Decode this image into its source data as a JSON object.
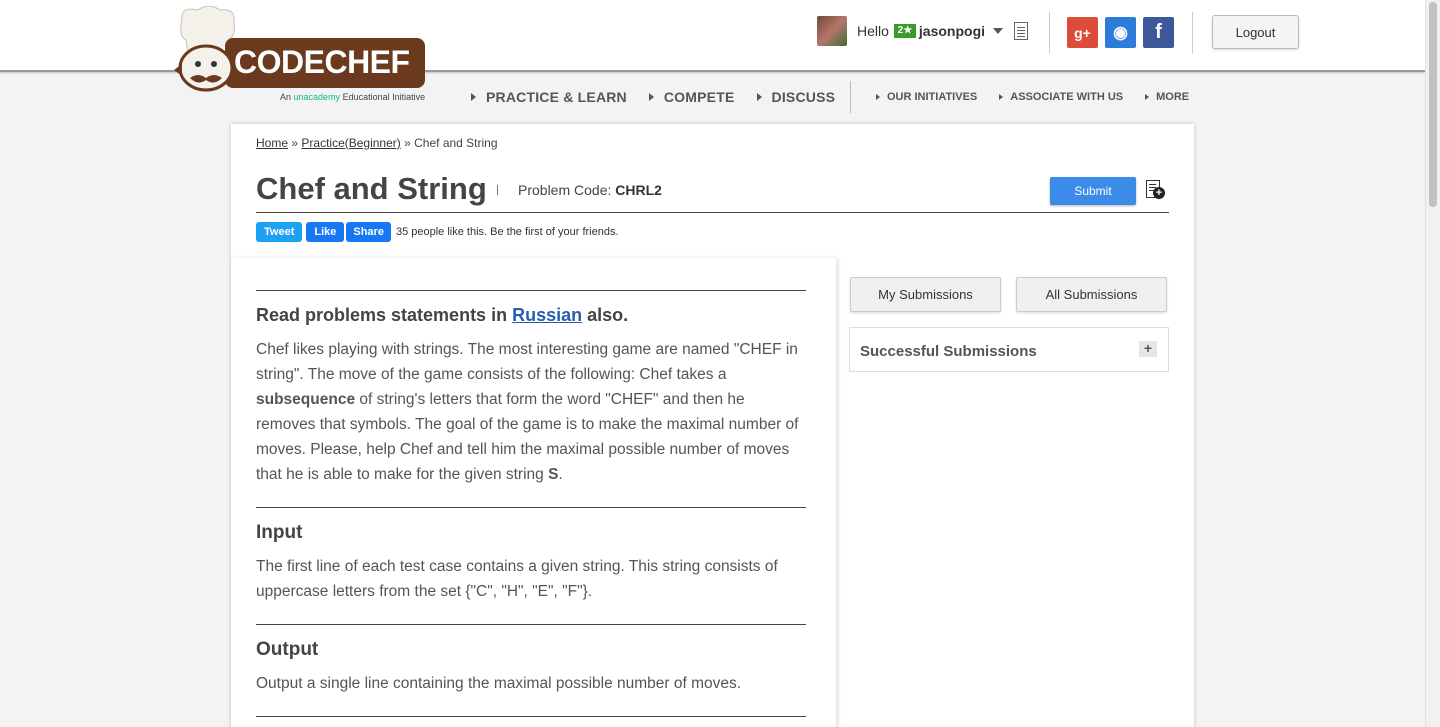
{
  "header": {
    "logo_text": "CODECHEF",
    "logo_sub_prefix": "An",
    "logo_sub_brand": "unacademy",
    "logo_sub_suffix": "Educational Initiative",
    "greeting": "Hello",
    "star_badge": "2★",
    "username": "jasonpogi",
    "social": {
      "gplus": "g+",
      "github": "◉",
      "facebook": "f"
    },
    "logout_label": "Logout"
  },
  "nav": {
    "main": [
      "PRACTICE & LEARN",
      "COMPETE",
      "DISCUSS"
    ],
    "secondary": [
      "OUR INITIATIVES",
      "ASSOCIATE WITH US",
      "MORE"
    ]
  },
  "breadcrumb": {
    "home": "Home",
    "sep1": "»",
    "practice": "Practice(Beginner)",
    "sep2": "»",
    "current": "Chef and String"
  },
  "problem": {
    "title": "Chef and String",
    "code_label": "Problem Code:",
    "code": "CHRL2",
    "submit_label": "Submit"
  },
  "share": {
    "tweet": "Tweet",
    "like": "Like",
    "share": "Share",
    "likes_text": "35 people like this. Be the first of your friends."
  },
  "statement": {
    "read_prefix": "Read problems statements in",
    "read_link": "Russian",
    "read_suffix": "also.",
    "body_1": "Chef likes playing with strings. The most interesting game are named \"CHEF in string\". The move of the game consists of the following: Chef takes a",
    "body_bold": "subsequence",
    "body_2": "of string's letters that form the word \"CHEF\" and then he removes that symbols. The goal of the game is to make the maximal number of moves. Please, help Chef and tell him the maximal possible number of moves that he is able to make for the given string",
    "body_var": "S",
    "body_end": ".",
    "input_heading": "Input",
    "input_text": "The first line of each test case contains a given string. This string consists of uppercase letters from the set {\"C\", \"H\", \"E\", \"F\"}.",
    "output_heading": "Output",
    "output_text": "Output a single line containing the maximal possible number of moves."
  },
  "sidebar": {
    "my_submissions": "My Submissions",
    "all_submissions": "All Submissions",
    "successful_submissions": "Successful Submissions",
    "expand": "+"
  },
  "colors": {
    "submit": "#3d8be8",
    "link": "#2a5db0",
    "tweet": "#1da1f2",
    "facebook": "#1877f2",
    "gplus": "#dd4b39",
    "logo_brown": "#6b3a1e"
  }
}
